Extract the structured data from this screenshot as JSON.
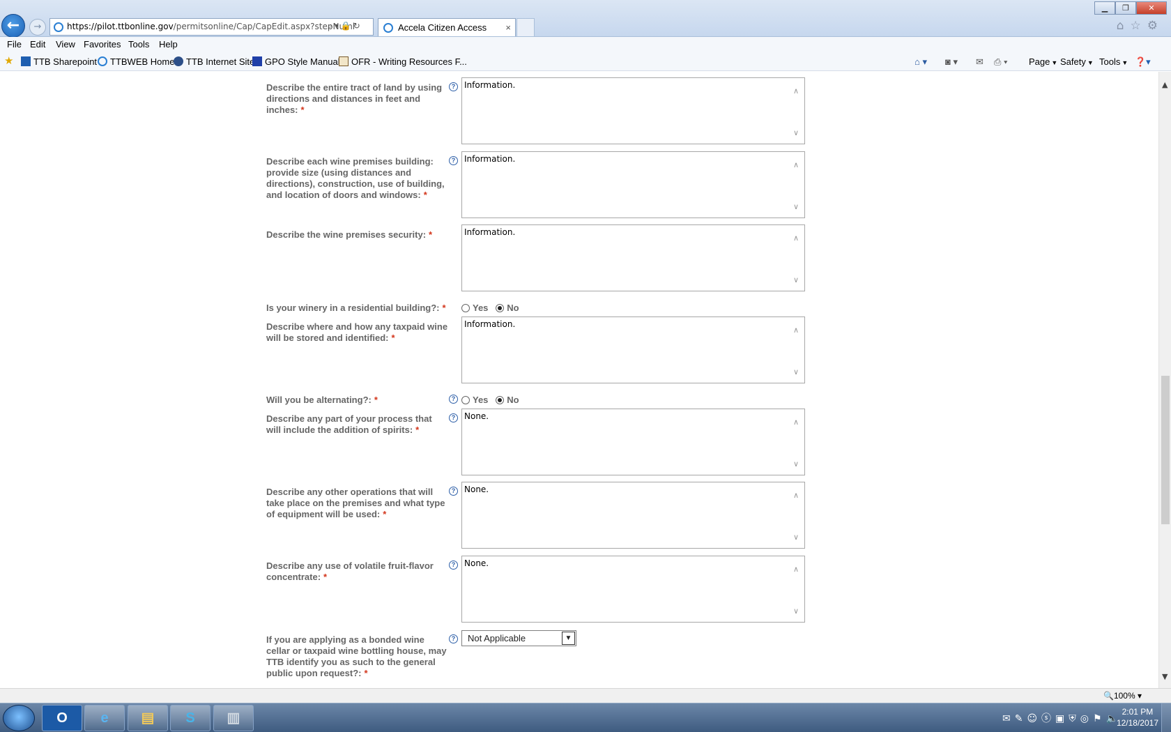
{
  "browser": {
    "address": {
      "host": "https://pilot.ttbonline.gov",
      "path": "/permitsonline/Cap/CapEdit.aspx?stepNuml"
    },
    "tab_title": "Accela Citizen Access",
    "tab_close": "×",
    "menu": [
      "File",
      "Edit",
      "View",
      "Favorites",
      "Tools",
      "Help"
    ],
    "favorites": [
      "TTB Sharepoint",
      "TTBWEB Home",
      "TTB Internet Site",
      "GPO Style Manual",
      "OFR - Writing Resources F..."
    ],
    "commands": [
      "Page",
      "Safety",
      "Tools"
    ],
    "zoom": "100%"
  },
  "form": {
    "required_mark": "*",
    "help_glyph": "?",
    "fields": [
      {
        "label": "Describe the entire tract of land by using directions and distances in feet and inches:",
        "value": "Information."
      },
      {
        "label": "Describe each wine premises building: provide size (using distances and directions), construction, use of building, and location of doors and windows:",
        "value": "Information."
      },
      {
        "label": "Describe the wine premises security:",
        "value": "Information."
      },
      {
        "label": "Is your winery in a residential building?:",
        "yes": "Yes",
        "no": "No",
        "selected": "No"
      },
      {
        "label": "Describe where and how any taxpaid wine will be stored and identified:",
        "value": "Information."
      },
      {
        "label": "Will you be alternating?:",
        "yes": "Yes",
        "no": "No",
        "selected": "No"
      },
      {
        "label": "Describe any part of your process that will include the addition of spirits:",
        "value": "None."
      },
      {
        "label": "Describe any other operations that will take place on the premises and what type of equipment will be used:",
        "value": "None."
      },
      {
        "label": "Describe any use of volatile fruit-flavor concentrate:",
        "value": "None."
      },
      {
        "label": "If you are applying as a bonded wine cellar or taxpaid wine bottling house, may TTB identify you as such to the general public upon request?:",
        "value": "Not Applicable"
      }
    ]
  },
  "taskbar": {
    "time": "2:01 PM",
    "date": "12/18/2017"
  },
  "icons": [
    "back-arrow-icon",
    "forward-arrow-icon",
    "ie-icon",
    "home-icon",
    "star-icon",
    "gear-icon",
    "help-icon",
    "windows-start-icon",
    "outlook-icon",
    "folder-icon",
    "skype-icon"
  ]
}
